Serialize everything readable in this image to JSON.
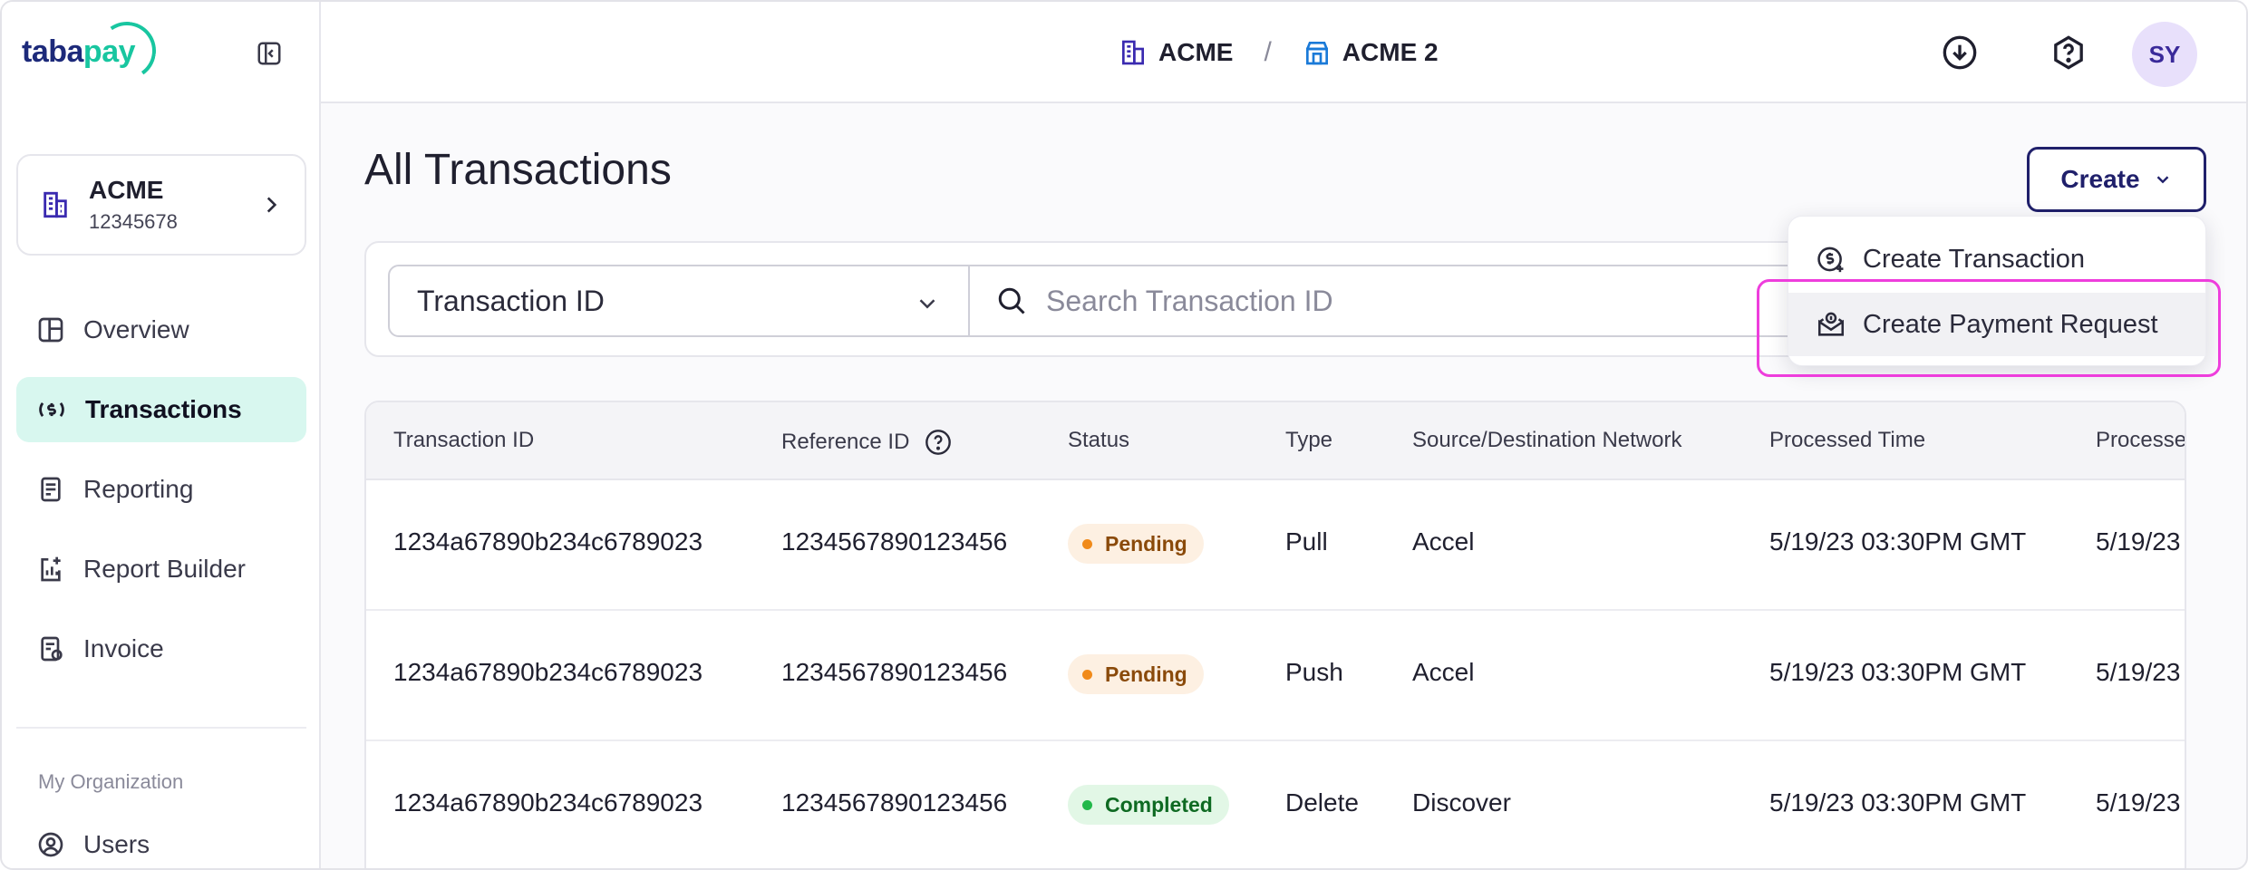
{
  "brand": {
    "logo_a": "taba",
    "logo_b": "pay",
    "accent": "#18c6a0",
    "navy": "#20206b"
  },
  "topbar": {
    "breadcrumb": [
      {
        "label": "ACME",
        "icon": "building-icon"
      },
      {
        "label": "ACME 2",
        "icon": "store-icon"
      }
    ],
    "separator": "/",
    "avatar_initials": "SY"
  },
  "sidebar": {
    "org": {
      "name": "ACME",
      "id": "12345678"
    },
    "items": [
      {
        "label": "Overview",
        "icon": "overview-icon"
      },
      {
        "label": "Transactions",
        "icon": "transactions-icon",
        "active": true
      },
      {
        "label": "Reporting",
        "icon": "reporting-icon"
      },
      {
        "label": "Report Builder",
        "icon": "report-builder-icon"
      },
      {
        "label": "Invoice",
        "icon": "invoice-icon"
      }
    ],
    "section_label": "My Organization",
    "users_label": "Users"
  },
  "main": {
    "title": "All Transactions",
    "create_label": "Create",
    "filter": {
      "selected": "Transaction ID",
      "search_placeholder": "Search Transaction ID"
    },
    "dropdown": {
      "items": [
        {
          "label": "Create Transaction",
          "icon": "dollar-plus-icon"
        },
        {
          "label": "Create Payment Request",
          "icon": "money-envelope-icon"
        }
      ]
    },
    "table": {
      "headers": [
        "Transaction ID",
        "Reference ID",
        "Status",
        "Type",
        "Source/Destination Network",
        "Processed Time",
        "Processe"
      ],
      "rows": [
        {
          "transaction_id": "1234a67890b234c6789023",
          "reference_id": "1234567890123456",
          "status": "Pending",
          "type": "Pull",
          "network": "Accel",
          "processed_time": "5/19/23 03:30PM GMT",
          "processed_trunc": "5/19/23"
        },
        {
          "transaction_id": "1234a67890b234c6789023",
          "reference_id": "1234567890123456",
          "status": "Pending",
          "type": "Push",
          "network": "Accel",
          "processed_time": "5/19/23 03:30PM GMT",
          "processed_trunc": "5/19/23"
        },
        {
          "transaction_id": "1234a67890b234c6789023",
          "reference_id": "1234567890123456",
          "status": "Completed",
          "type": "Delete",
          "network": "Discover",
          "processed_time": "5/19/23 03:30PM GMT",
          "processed_trunc": "5/19/23"
        }
      ]
    }
  },
  "status_colors": {
    "pending": "#f08a1a",
    "completed": "#22b84a",
    "highlight": "#ee3ddc"
  }
}
